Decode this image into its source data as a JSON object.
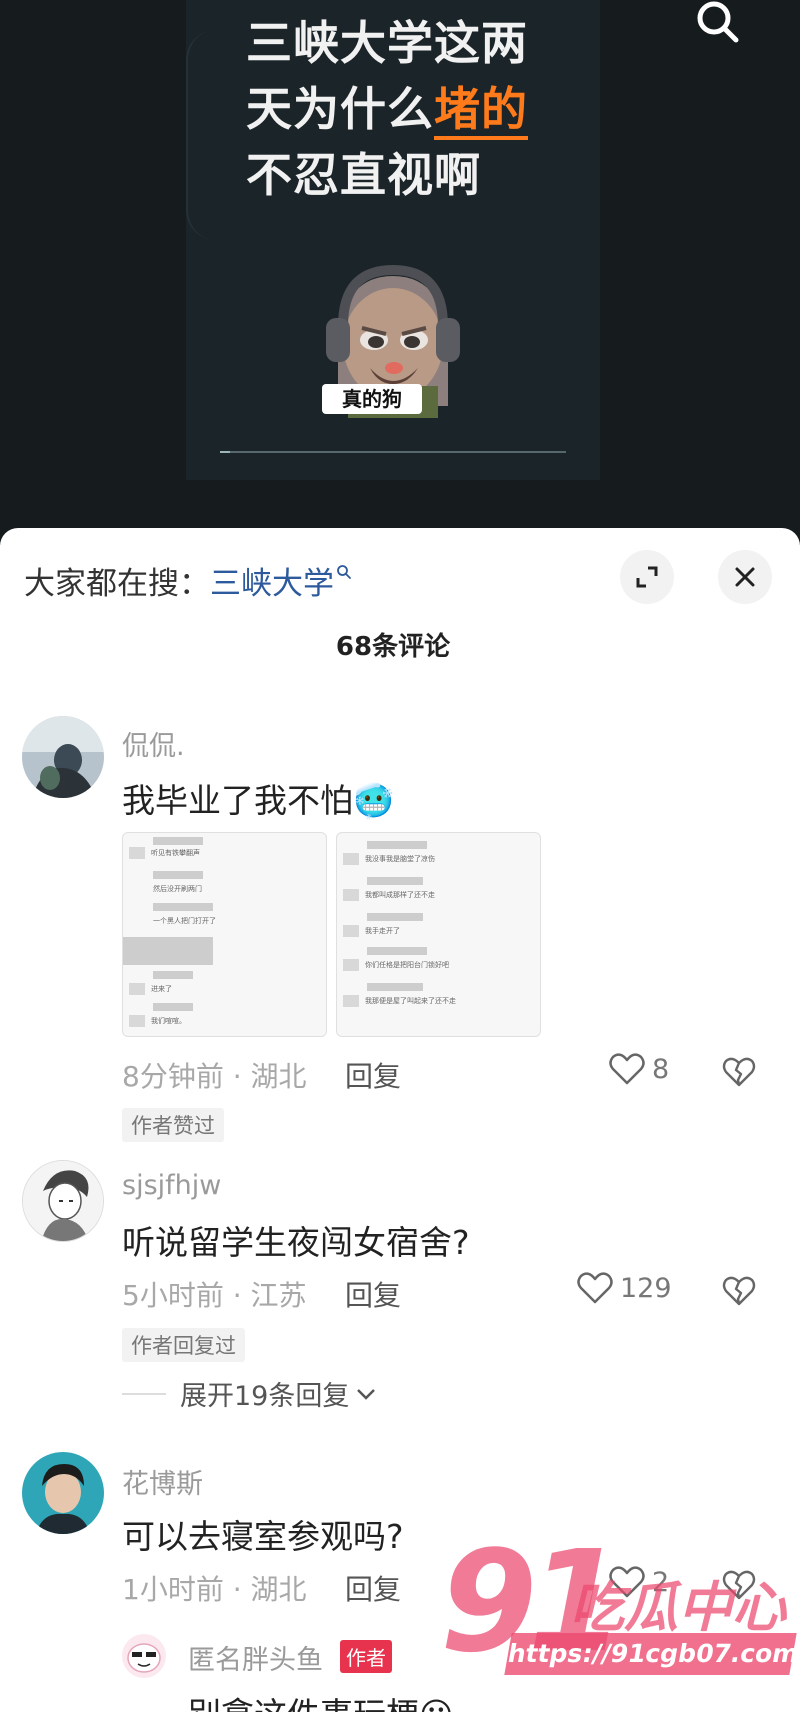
{
  "video": {
    "title_line1": "三峡大学这两",
    "title_line2_a": "天为什么",
    "title_line2_b": "堵的",
    "title_line3": "不忍直视啊",
    "sticker_text": "真的狗",
    "progress": 0.03,
    "search_icon": "search-icon"
  },
  "sheet": {
    "trending_prefix": "大家都在搜：",
    "trending_keyword": "三峡大学",
    "comment_count": "68条评论",
    "expand_icon": "expand-icon",
    "close_icon": "close-icon"
  },
  "comments": [
    {
      "username": "侃侃.",
      "text": "我毕业了我不怕",
      "emoji": "🥶",
      "time_location": "8分钟前 · 湖北",
      "reply_label": "回复",
      "likes": "8",
      "tag": "作者赞过",
      "screenshots": [
        {
          "lines": [
            "听见有铁攀翻声",
            "然后没开刷两门",
            "一个黑人把门打开了",
            "进来了",
            "我们喧喧。"
          ]
        },
        {
          "lines": [
            "我没事我是脑堂了凉伤",
            "我都叫成那样了还不走",
            "我手走开了",
            "你们任格是把阳台门锁好吧",
            "我那便是屋了叫起来了还不走"
          ]
        }
      ]
    },
    {
      "username": "sjsjfhjw",
      "text": "听说留学生夜闯女宿舍?",
      "time_location": "5小时前 · 江苏",
      "reply_label": "回复",
      "likes": "129",
      "tag": "作者回复过",
      "expand_replies": "展开19条回复"
    },
    {
      "username": "花博斯",
      "text": "可以去寝室参观吗?",
      "time_location": "1小时前 · 湖北",
      "reply_label": "回复",
      "likes": "2"
    }
  ],
  "sub_reply": {
    "username": "匿名胖头鱼",
    "badge": "作者",
    "text": "别拿这件事玩梗",
    "emoji": "😕"
  },
  "watermark": {
    "number": "91",
    "text": "吃瓜中心",
    "url": "https://91cgb07.com"
  },
  "colors": {
    "accent_orange": "#ff7a1a",
    "link_blue": "#2d5a9c",
    "author_red": "#e8334e",
    "watermark_pink": "#ec486e"
  }
}
